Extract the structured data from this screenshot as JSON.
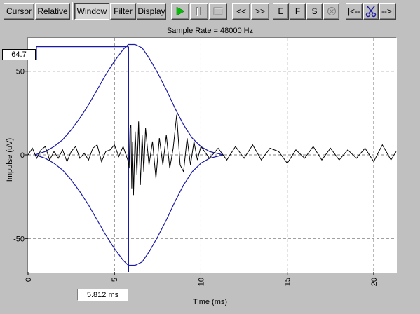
{
  "toolbar": {
    "cursor": "Cursor",
    "relative": "Relative",
    "window": "Window",
    "filter": "Filter",
    "display": "Display",
    "rewind": "<<",
    "forward": ">>",
    "e": "E",
    "f": "F",
    "s": "S",
    "trim_left": "|<--",
    "trim_right": "-->|"
  },
  "cursor_value": "64.7",
  "time_readout": "5.812 ms",
  "chart_data": {
    "type": "line",
    "title": "Sample Rate = 48000 Hz",
    "xlabel": "Time (ms)",
    "ylabel": "Impulse (uV)",
    "xlim": [
      0,
      21.3
    ],
    "ylim": [
      -70,
      70
    ],
    "x_ticks": [
      0,
      5,
      10,
      15,
      20
    ],
    "y_ticks": [
      50,
      0,
      -50
    ],
    "grid": true,
    "cursor_x_ms": 5.812,
    "window_envelope": {
      "name": "window",
      "color": "#1a1aa6",
      "x": [
        0.4,
        1.0,
        1.5,
        2.0,
        2.5,
        3.0,
        3.5,
        4.0,
        4.5,
        5.0,
        5.5,
        5.8,
        6.2,
        6.6,
        7.0,
        7.5,
        8.0,
        8.5,
        9.0,
        9.5,
        10.0,
        10.5,
        11.3
      ],
      "y": [
        0,
        2,
        5,
        9,
        15,
        22,
        30,
        39,
        48,
        56,
        63,
        66,
        66,
        64,
        58,
        49,
        39,
        28,
        18,
        10,
        5,
        2,
        0
      ]
    },
    "marker_line": {
      "x": 5.812,
      "y_top": 64.7,
      "color": "#1a1aa6"
    },
    "signal": {
      "name": "impulse",
      "color": "#000000",
      "x": [
        0.0,
        0.25,
        0.5,
        0.75,
        1.0,
        1.25,
        1.5,
        1.75,
        2.0,
        2.25,
        2.5,
        2.75,
        3.0,
        3.25,
        3.5,
        3.75,
        4.0,
        4.25,
        4.5,
        4.75,
        5.0,
        5.25,
        5.5,
        5.7,
        5.8,
        5.85,
        5.9,
        5.95,
        6.0,
        6.05,
        6.1,
        6.2,
        6.3,
        6.4,
        6.5,
        6.6,
        6.7,
        6.8,
        7.0,
        7.2,
        7.4,
        7.6,
        7.8,
        8.0,
        8.2,
        8.4,
        8.6,
        8.8,
        9.0,
        9.2,
        9.4,
        9.6,
        9.8,
        10.0,
        10.5,
        11.0,
        11.5,
        12.0,
        12.5,
        13.0,
        13.5,
        14.0,
        14.5,
        15.0,
        15.5,
        16.0,
        16.5,
        17.0,
        17.5,
        18.0,
        18.5,
        19.0,
        19.5,
        20.0,
        20.5,
        21.0,
        21.3
      ],
      "y": [
        0,
        4,
        -2,
        3,
        5,
        -3,
        2,
        -2,
        3,
        -4,
        2,
        5,
        -2,
        1,
        -3,
        4,
        6,
        -4,
        2,
        3,
        6,
        -1,
        5,
        -1,
        -4,
        -8,
        16,
        18,
        -20,
        8,
        -24,
        14,
        -12,
        20,
        -18,
        12,
        -10,
        16,
        -6,
        8,
        -14,
        10,
        -6,
        12,
        -8,
        4,
        24,
        -6,
        -10,
        10,
        -6,
        8,
        -3,
        5,
        -2,
        4,
        -3,
        5,
        -2,
        6,
        -3,
        4,
        2,
        -5,
        3,
        -2,
        5,
        -3,
        4,
        -3,
        3,
        -2,
        4,
        -4,
        6,
        -3,
        2
      ]
    }
  }
}
